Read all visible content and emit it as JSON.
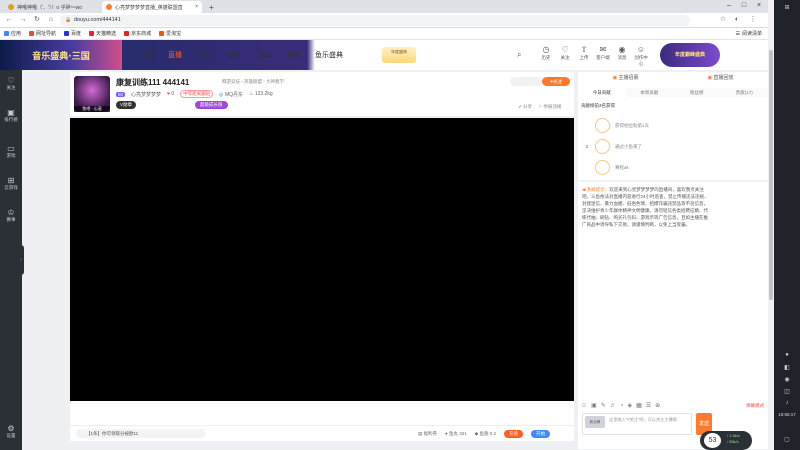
{
  "browser": {
    "tabs": [
      {
        "label": "神哦神哦（'、'）〉o 乎碎～wo",
        "fav_color": "#e0a020"
      },
      {
        "label": "心亮梦梦梦梦直播_英雄联盟直",
        "fav_color": "#ff7a2b",
        "close": "×"
      }
    ],
    "new_tab": "+",
    "url": "douyu.com/444141",
    "window_min": "–",
    "window_max": "□",
    "window_close": "×",
    "bookmarks": [
      {
        "label": "应用",
        "color": "#4285f4"
      },
      {
        "label": "网址导航",
        "color": "#e84a3c"
      },
      {
        "label": "百度",
        "color": "#2932e1"
      },
      {
        "label": "天猫精选",
        "color": "#e8222f"
      },
      {
        "label": "京东商城",
        "color": "#e1251b"
      },
      {
        "label": "爱淘宝",
        "color": "#ff5000"
      }
    ],
    "reading_list": "阅读清单"
  },
  "site": {
    "banner_text": "音乐盛典·三国",
    "nav": [
      "首页",
      "直播",
      "分类·",
      "视频·",
      "游戏·",
      "鱼吧",
      "鱼乐盛典"
    ],
    "active_nav": 1,
    "promo": "年度盛典",
    "header_icons": [
      {
        "icon": "history-icon",
        "glyph": "◷",
        "label": "历史"
      },
      {
        "icon": "follow-icon",
        "glyph": "♡",
        "label": "关注"
      },
      {
        "icon": "upload-icon",
        "glyph": "⇧",
        "label": "上传"
      },
      {
        "icon": "mail-icon",
        "glyph": "✉",
        "label": "客户端"
      },
      {
        "icon": "bulb-icon",
        "glyph": "◉",
        "label": "消息"
      },
      {
        "icon": "user-icon",
        "glyph": "☺",
        "label": "创作中心"
      }
    ],
    "badge_text": "年度巅峰盛典"
  },
  "left_sidebar": [
    {
      "icon": "heart-icon",
      "glyph": "♡",
      "label": "关注"
    },
    {
      "icon": "recommend-icon",
      "glyph": "▣",
      "label": "排行榜"
    },
    {
      "icon": "game-icon",
      "glyph": "▭",
      "label": "游戏"
    },
    {
      "icon": "gamepad-icon",
      "glyph": "⊞",
      "label": "云游戏"
    },
    {
      "icon": "trophy-icon",
      "glyph": "♔",
      "label": "赛事"
    },
    {
      "icon": "settings-icon",
      "glyph": "⚙",
      "label": "设置"
    }
  ],
  "room": {
    "title": "康复训练111 444141",
    "category": "网游竞技 › 英雄联盟 › 大神教学",
    "level": "50",
    "name": "心亮梦梦梦梦",
    "likes": "0",
    "tag": "中等距离蹦哒",
    "location": "MQ丹东",
    "hot": "123.2kg",
    "avatar_tag": "鱼吧 · 心宠",
    "v_badge": "V勋章",
    "purple": "超级成长值",
    "follow_btn": "关注",
    "share": "分享",
    "report": "举报违规"
  },
  "below": {
    "gift_msg": "【1条】你可领取分被欧11",
    "fans": "福利券",
    "count1": "鱼丸 321",
    "count2": "鱼翅 0.2",
    "btn_red": "充值",
    "btn_blue": "开始"
  },
  "right_panel": {
    "tabs": [
      "主播招募",
      "直播回放"
    ],
    "rank_tabs": [
      "今日贡献",
      "本周贡献",
      "粉丝榜",
      "贵族(17)"
    ],
    "rank_header": "贡献榜前3名获得",
    "ranks": [
      {
        "num": "",
        "text": "获得他位助第1天"
      },
      {
        "num": "2",
        "text": "通过小鱼来了"
      },
      {
        "num": "",
        "text": "赛程ak"
      }
    ],
    "system_label": "系统提示：",
    "system_text": "欢迎来到心亮梦梦梦梦的直播间，喜欢我点关注吧。斗鱼依法对直播内容进行24小时巡查，禁止传播违法违规、封建迷信、暴力血腥、低俗色情、招嫖诈骗违禁品等不良信息，坚决维护青少年群体精神文明健康。请勿轻信各类招聘征婚、代练代抽、刷钻、购买礼包码、游戏币等广告信息，且如主播在推广商品中诱导私下交易，请谨慎判断，以免上当受骗。",
    "tools": [
      "☺",
      "▣",
      "✎",
      "♬",
      "◔",
      "◈",
      "▦",
      "☰",
      "⊕"
    ],
    "tools_red": "弹幕模式",
    "chat_chip": "粉丝牌",
    "chat_placeholder": "这里输入“#关注”吧，可以关注主播哦",
    "send": "发送"
  },
  "widget": {
    "num": "53",
    "up": "↑ 1.5k/s",
    "down": "↓ 55k/s"
  },
  "taskbar": {
    "time": "19:56:17"
  }
}
